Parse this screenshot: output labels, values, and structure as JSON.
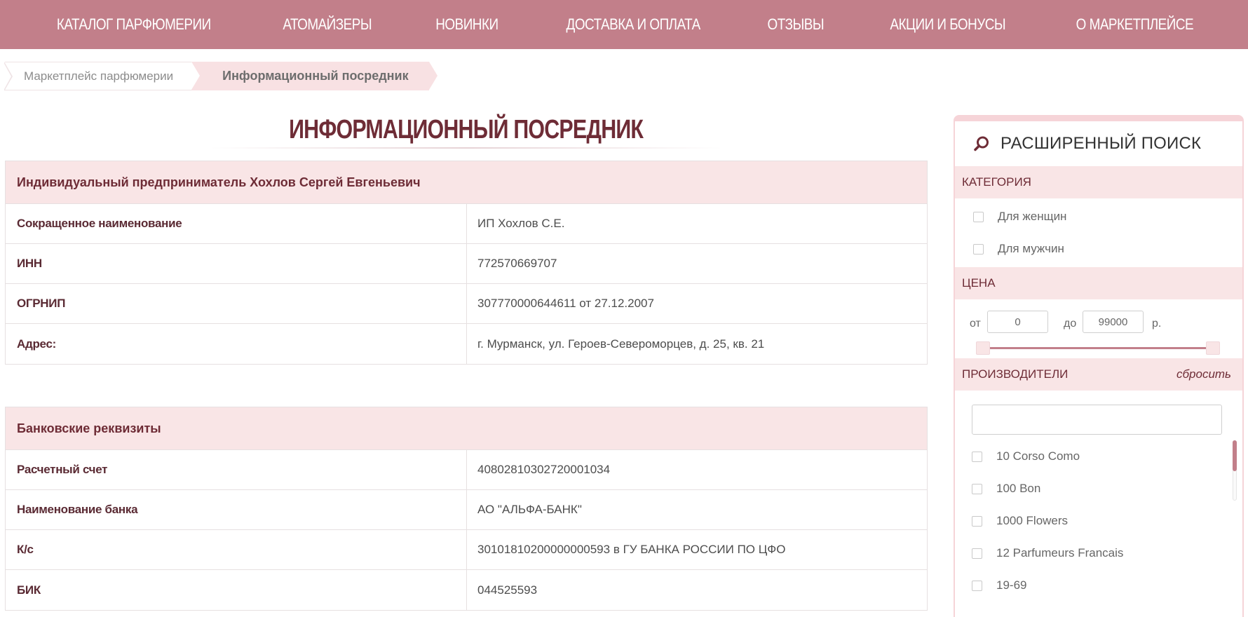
{
  "nav": {
    "items": [
      "КАТАЛОГ ПАРФЮМЕРИИ",
      "АТОМАЙЗЕРЫ",
      "НОВИНКИ",
      "ДОСТАВКА И ОПЛАТА",
      "ОТЗЫВЫ",
      "АКЦИИ И БОНУСЫ",
      "О МАРКЕТПЛЕЙСЕ"
    ]
  },
  "breadcrumb": {
    "home": "Маркетплейс парфюмерии",
    "current": "Информационный посредник"
  },
  "page_title": "ИНФОРМАЦИОННЫЙ ПОСРЕДНИК",
  "entrepreneur": {
    "heading": "Индивидуальный предприниматель Хохлов Сергей Евгеньевич",
    "rows": [
      {
        "key": "Сокращенное наименование",
        "value": "ИП Хохлов С.Е."
      },
      {
        "key": "ИНН",
        "value": "772570669707"
      },
      {
        "key": "ОГРНИП",
        "value": "307770000644611 от 27.12.2007"
      },
      {
        "key": "Адрес:",
        "value": "г. Мурманск, ул. Героев-Североморцев, д. 25, кв. 21"
      }
    ]
  },
  "bank": {
    "heading": "Банковские реквизиты",
    "rows": [
      {
        "key": "Расчетный счет",
        "value": "40802810302720001034"
      },
      {
        "key": "Наименование банка",
        "value": "АО \"АЛЬФА-БАНК\""
      },
      {
        "key": "К/с",
        "value": "30101810200000000593 в ГУ БАНКА РОССИИ ПО ЦФО"
      },
      {
        "key": "БИК",
        "value": "044525593"
      }
    ]
  },
  "sidebar": {
    "title": "РАСШИРЕННЫЙ ПОИСК",
    "category_label": "КАТЕГОРИЯ",
    "categories": [
      "Для женщин",
      "Для мужчин"
    ],
    "price_label": "ЦЕНА",
    "price_from_label": "от",
    "price_from_value": "0",
    "price_to_label": "до",
    "price_to_value": "99000",
    "price_currency": "р.",
    "manufacturers_label": "ПРОИЗВОДИТЕЛИ",
    "reset_label": "сбросить",
    "manufacturer_search_placeholder": "",
    "manufacturers": [
      "10 Corso Como",
      "100 Bon",
      "1000 Flowers",
      "12 Parfumeurs Francais",
      "19-69"
    ]
  },
  "colors": {
    "nav_bg": "#c27f8a",
    "accent_pink": "#f9e5e6",
    "text_dark_red": "#6e2c36"
  }
}
